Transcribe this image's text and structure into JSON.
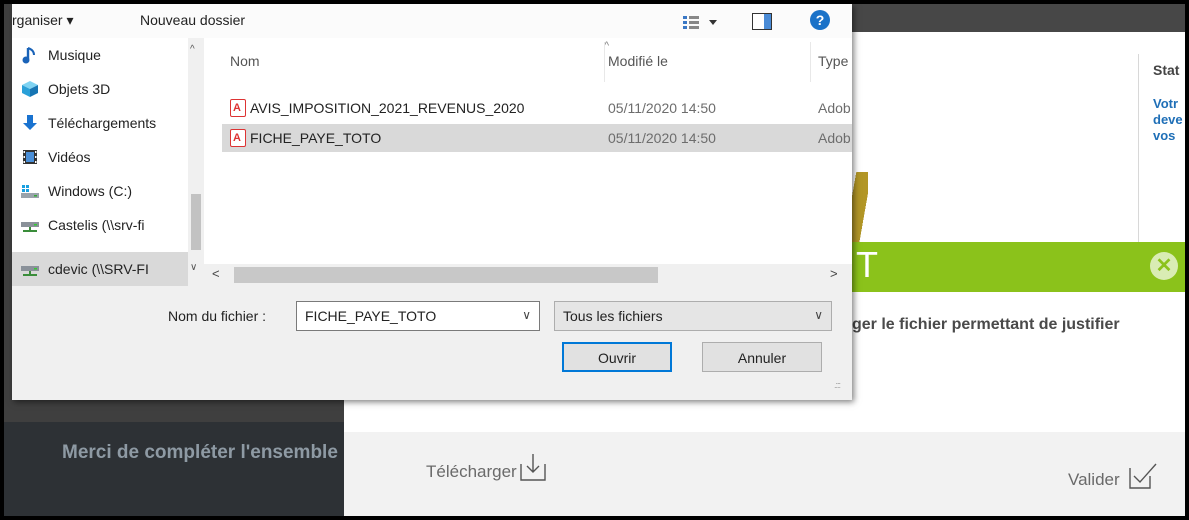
{
  "background": {
    "left_message": "Merci de compléter l'ensemble",
    "stat_title": "Stat",
    "stat_lines": [
      "Votr",
      "deve",
      "vos"
    ],
    "modal_title_letter": "T",
    "modal_text": "ger le fichier permettant de justifier",
    "download_label": "Télécharger",
    "validate_label": "Valider",
    "close_symbol": "✕",
    "colors": {
      "green": "#8bc21b",
      "link_blue": "#1f6fb7",
      "dark": "#2d3135"
    }
  },
  "dialog": {
    "toolbar": {
      "organise_label": "rganiser ▾",
      "new_folder_label": "Nouveau dossier",
      "help_symbol": "?"
    },
    "nav_items": [
      {
        "label": "Musique",
        "icon": "music-note-icon"
      },
      {
        "label": "Objets 3D",
        "icon": "cube-3d-icon"
      },
      {
        "label": "Téléchargements",
        "icon": "download-arrow-icon"
      },
      {
        "label": "Vidéos",
        "icon": "film-icon"
      },
      {
        "label": "Windows (C:)",
        "icon": "drive-icon"
      },
      {
        "label": "Castelis (\\\\srv-fi",
        "icon": "network-drive-icon"
      },
      {
        "label": "cdevic (\\\\SRV-FI",
        "icon": "network-drive-icon",
        "selected": true
      }
    ],
    "columns": {
      "name": "Nom",
      "modified": "Modifié le",
      "type": "Type"
    },
    "files": [
      {
        "name": "AVIS_IMPOSITION_2021_REVENUS_2020",
        "modified": "05/11/2020 14:50",
        "type": "Adob"
      },
      {
        "name": "FICHE_PAYE_TOTO",
        "modified": "05/11/2020 14:50",
        "type": "Adob",
        "selected": true
      }
    ],
    "filename_label": "Nom du fichier :",
    "filename_value": "FICHE_PAYE_TOTO",
    "filetype_value": "Tous les fichiers",
    "open_label": "Ouvrir",
    "cancel_label": "Annuler"
  }
}
